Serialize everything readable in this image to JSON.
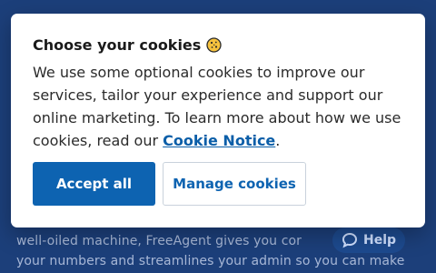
{
  "background": {
    "line1": "well-oiled machine, FreeAgent gives you cor",
    "line2": "your numbers and streamlines your admin so you can make"
  },
  "help_widget": {
    "label": "Help",
    "icon": "speech-bubble-icon"
  },
  "modal": {
    "title": "Choose your cookies",
    "title_icon": "cookie-icon",
    "body_text": "We use some optional cookies to improve our services, tailor your experience and support our online marketing. To learn more about how we use cookies, read our ",
    "link_text": "Cookie Notice",
    "after_link": ".",
    "accept_label": "Accept all",
    "manage_label": "Manage cookies"
  },
  "colors": {
    "accent": "#0d63b1",
    "backdrop": "#1c3f7a",
    "link": "#0b5ea8"
  }
}
